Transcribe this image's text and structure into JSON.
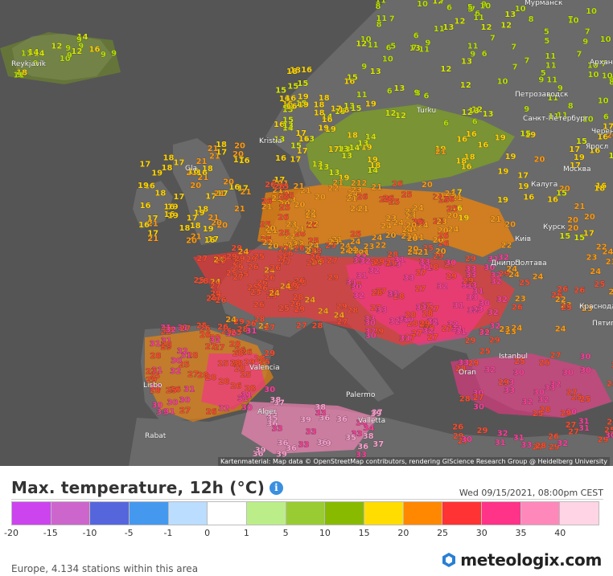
{
  "map": {
    "attribution": "Kartenmaterial: Map data © OpenStreetMap contributors, rendering GIScience Research Group @ Heidelberg University",
    "place_labels": [
      "Reykjavík",
      "Kristia",
      "Turku",
      "Санкт-Петербург",
      "Петрозаводск",
      "Мурманск",
      "Архан",
      "Черен",
      "Яросл",
      "Москва",
      "Калуга",
      "Курск",
      "Киів",
      "Днипро",
      "Полтава",
      "Краснодар",
      "Пятигорск",
      "Istanbul",
      "Oran",
      "Alger",
      "Rabat",
      "Palermo",
      "Valletta",
      "Valencia",
      "Lisbo",
      "Gla"
    ],
    "temperature_readings": [
      "10",
      "9",
      "16",
      "14",
      "18",
      "12",
      "11",
      "15",
      "17",
      "19",
      "20",
      "21",
      "22",
      "23",
      "24",
      "25",
      "26",
      "27",
      "28",
      "29",
      "30",
      "31",
      "32",
      "33",
      "34",
      "35",
      "36",
      "37",
      "38",
      "39",
      "7",
      "8",
      "6",
      "13",
      "5"
    ]
  },
  "header": {
    "title": "Max. temperature, 12h (°C)",
    "info_icon": "i",
    "datetime": "Wed 09/15/2021, 08:00pm CEST"
  },
  "legend": {
    "colors": [
      "#cc44ee",
      "#cc66cc",
      "#5566dd",
      "#4499ee",
      "#bbddff",
      "#ffffff",
      "#bbee88",
      "#99cc33",
      "#88bb00",
      "#ffdd00",
      "#ff8800",
      "#ff3333",
      "#ff3388",
      "#ff88bb",
      "#ffd5e5"
    ],
    "ticks": [
      "-20",
      "-15",
      "-10",
      "-5",
      "-1",
      "0",
      "1",
      "5",
      "10",
      "15",
      "20",
      "25",
      "30",
      "35",
      "40"
    ]
  },
  "footer": {
    "stations_text": "Europe, 4.134 stations within this area",
    "brand": "meteologix.com"
  }
}
